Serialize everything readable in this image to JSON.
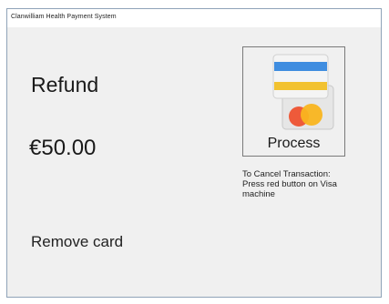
{
  "window": {
    "title": "Clanwilliam Health Payment System"
  },
  "main": {
    "status": "Refund",
    "amount": "€50.00",
    "instruction": "Remove card"
  },
  "process_button": {
    "label": "Process",
    "icon": "credit-cards-icon"
  },
  "cancel_note": {
    "line1": "To Cancel Transaction:",
    "line2": "Press red button on Visa",
    "line3": "machine"
  },
  "colors": {
    "card_blue": "#3f8de0",
    "card_yellow": "#f2c230",
    "card_red": "#ee5a3a",
    "card_orange": "#f9b51f"
  }
}
